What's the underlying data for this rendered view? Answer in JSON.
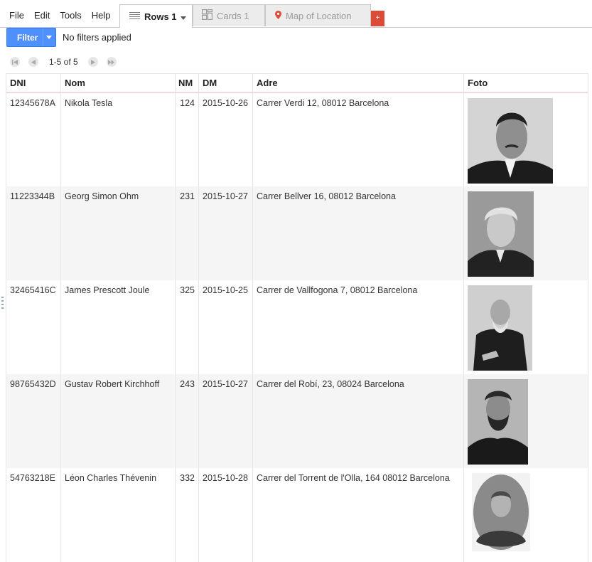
{
  "menu": [
    "File",
    "Edit",
    "Tools",
    "Help"
  ],
  "tabs": [
    {
      "label": "Rows 1",
      "icon": "rows-icon",
      "active": true
    },
    {
      "label": "Cards 1",
      "icon": "cards-icon",
      "active": false
    },
    {
      "label": "Map of Location",
      "icon": "map-pin-icon",
      "active": false
    }
  ],
  "add_tab": "+",
  "filter": {
    "button": "Filter",
    "status": "No filters applied"
  },
  "pager": {
    "text": "1-5 of 5"
  },
  "table": {
    "columns": [
      "DNI",
      "Nom",
      "NM",
      "DM",
      "Adre",
      "Foto"
    ],
    "rows": [
      {
        "dni": "12345678A",
        "nom": "Nikola Tesla",
        "nm": "124",
        "dm": "2015-10-26",
        "adre": "Carrer Verdi 12, 08012 Barcelona"
      },
      {
        "dni": "11223344B",
        "nom": "Georg Simon Ohm",
        "nm": "231",
        "dm": "2015-10-27",
        "adre": "Carrer Bellver 16, 08012 Barcelona"
      },
      {
        "dni": "32465416C",
        "nom": "James Prescott Joule",
        "nm": "325",
        "dm": "2015-10-25",
        "adre": "Carrer de Vallfogona 7, 08012 Barcelona"
      },
      {
        "dni": "98765432D",
        "nom": "Gustav Robert Kirchhoff",
        "nm": "243",
        "dm": "2015-10-27",
        "adre": "Carrer del Robí, 23, 08024 Barcelona"
      },
      {
        "dni": "54763218E",
        "nom": "Léon Charles Thévenin",
        "nm": "332",
        "dm": "2015-10-28",
        "adre": "Carrer del Torrent de l'Olla, 164 08012 Barcelona"
      }
    ]
  },
  "colors": {
    "accent": "#4d90fe",
    "add_tab": "#dd4b39",
    "map_pin": "#dd4b39"
  }
}
